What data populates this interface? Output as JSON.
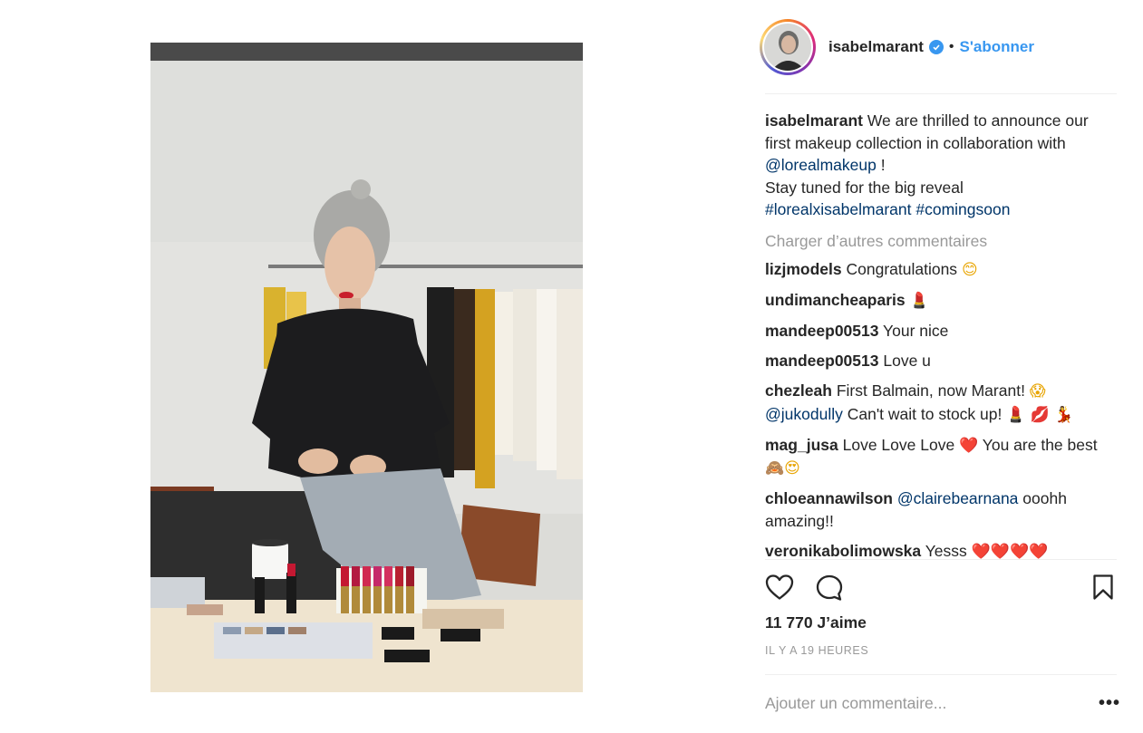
{
  "post": {
    "username": "isabelmarant",
    "follow_label": "S'abonner",
    "separator": "•",
    "caption": {
      "username": "isabelmarant",
      "line1": "We are thrilled to announce our first makeup collection in collaboration with",
      "mention": "@lorealmakeup",
      "after_mention": "!",
      "line2": "Stay tuned for the big reveal",
      "hashtag1": "#lorealxisabelmarant",
      "hashtag2": "#comingsoon"
    },
    "load_more_label": "Charger d’autres commentaires",
    "comments": [
      {
        "user": "lizjmodels",
        "text": "Congratulations",
        "emoji": "😊"
      },
      {
        "user": "undimancheaparis",
        "text": "",
        "emoji": "💄"
      },
      {
        "user": "mandeep00513",
        "text": "Your nice"
      },
      {
        "user": "mandeep00513",
        "text": "Love u"
      },
      {
        "user": "chezleah",
        "text": "First Balmain, now Marant!",
        "emoji": "😱",
        "mention": "@jukodully",
        "text2": "Can't wait to stock up!",
        "emoji2": "💄 💋 💃"
      },
      {
        "user": "mag_jusa",
        "text": "Love Love Love",
        "emoji": "❤️",
        "text2": "You are the best",
        "emoji2": "🙈😍"
      },
      {
        "user": "chloeannawilson",
        "mention": "@clairebearnana",
        "text": "ooohh amazing!!"
      },
      {
        "user": "veronikabolimowska",
        "text": "Yesss",
        "emoji": "❤️❤️❤️❤️"
      }
    ],
    "likes": "11 770 J’aime",
    "timestamp": "IL Y A 19 HEURES",
    "add_comment_placeholder": "Ajouter un commentaire...",
    "more_options": "•••",
    "icons": {
      "like": "heart-icon",
      "comment": "comment-bubble-icon",
      "save": "bookmark-icon",
      "verified": "verified-badge-icon"
    },
    "colors": {
      "link_blue": "#3897f0",
      "mention_blue": "#003569",
      "muted_gray": "#999999",
      "text": "#262626"
    }
  }
}
